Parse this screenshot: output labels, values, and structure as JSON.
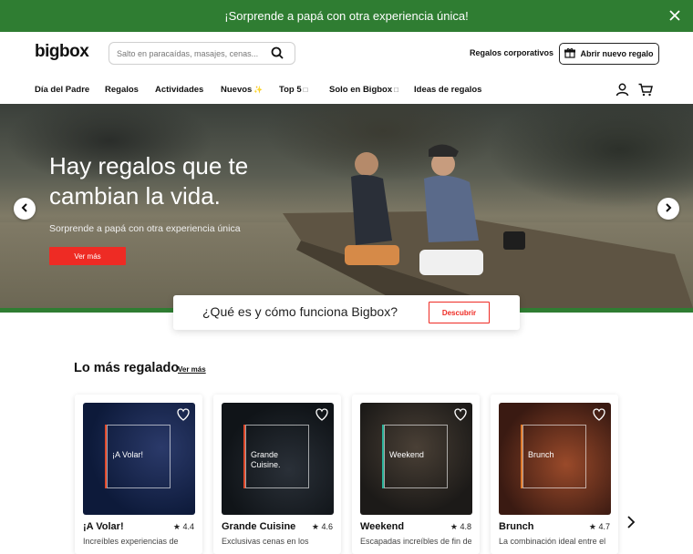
{
  "promo": {
    "text": "¡Sorprende a papá con otra experiencia única!"
  },
  "header": {
    "logo": "bigbox",
    "search_placeholder": "Salto en paracaídas, masajes, cenas...",
    "corporate_link": "Regalos corporativos",
    "open_gift_label": "Abrir nuevo regalo"
  },
  "nav": {
    "items": [
      {
        "label": "Día del Padre"
      },
      {
        "label": "Regalos"
      },
      {
        "label": "Actividades"
      },
      {
        "label": "Nuevos",
        "sym": "✨"
      },
      {
        "label": "Top 5",
        "sym": "□"
      },
      {
        "label": "Solo en Bigbox",
        "sym": "□"
      },
      {
        "label": "Ideas de regalos"
      }
    ]
  },
  "hero": {
    "title": "Hay regalos que te cambian la vida.",
    "subtitle": "Sorprende a papá con otra experiencia única",
    "cta_label": "Ver más"
  },
  "how": {
    "text": "¿Qué es y cómo funciona Bigbox?",
    "button_label": "Descubrir"
  },
  "section": {
    "title": "Lo más regalado",
    "see_more": "Ver más"
  },
  "cards": [
    {
      "title": "¡A Volar!",
      "rating": "4.4",
      "description": "Increíbles experiencias de",
      "image_label": "¡A Volar!",
      "bg": "#0d1a3a",
      "accent": "#e0482a"
    },
    {
      "title": "Grande Cuisine",
      "rating": "4.6",
      "description": "Exclusivas cenas en los",
      "image_label": "Grande Cuisine.",
      "bg": "#101418",
      "accent": "#e0482a"
    },
    {
      "title": "Weekend",
      "rating": "4.8",
      "description": "Escapadas increíbles de fin de",
      "image_label": "Weekend",
      "bg": "#1c1a18",
      "accent": "#2bb39a"
    },
    {
      "title": "Brunch",
      "rating": "4.7",
      "description": "La combinación ideal entre el",
      "image_label": "Brunch",
      "bg": "#3a1a12",
      "accent": "#e07a2a"
    }
  ],
  "colors": {
    "green": "#2f7d32",
    "red": "#ee2b24"
  },
  "icons": [
    "close-icon",
    "search-icon",
    "gift-icon",
    "user-icon",
    "cart-icon",
    "chevron-left-icon",
    "chevron-right-icon",
    "heart-icon",
    "star-icon"
  ]
}
